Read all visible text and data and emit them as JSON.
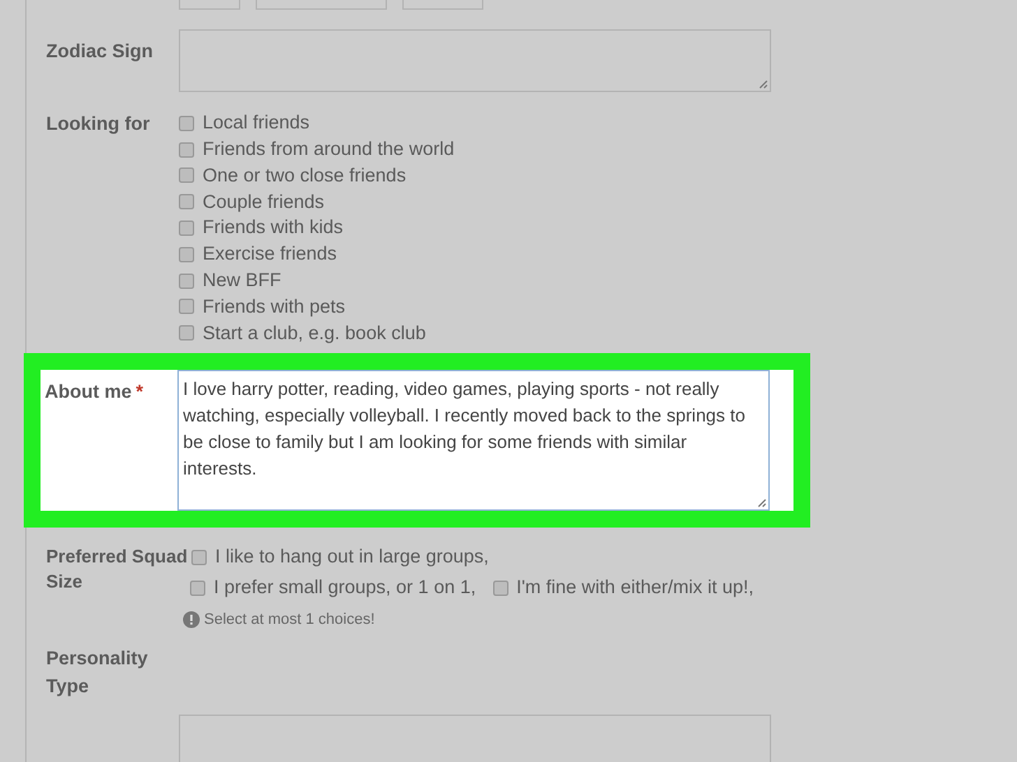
{
  "cut_off_fields": [
    {
      "kind": "field"
    },
    {
      "kind": "field"
    },
    {
      "kind": "field"
    }
  ],
  "zodiac": {
    "label": "Zodiac Sign"
  },
  "looking_for": {
    "label": "Looking for",
    "options": [
      {
        "label": "Local friends",
        "checked": false
      },
      {
        "label": "Friends from around the world",
        "checked": false
      },
      {
        "label": "One or two close friends",
        "checked": false
      },
      {
        "label": "Couple friends",
        "checked": false
      },
      {
        "label": "Friends with kids",
        "checked": false
      },
      {
        "label": "Exercise friends",
        "checked": false
      },
      {
        "label": "New BFF",
        "checked": false
      },
      {
        "label": "Friends with pets",
        "checked": false
      },
      {
        "label": "Start a club, e.g. book club",
        "checked": false
      }
    ]
  },
  "about_me": {
    "label": "About me",
    "required": true,
    "required_mark": "*",
    "highlighted": true,
    "value": "I love harry potter, reading, video games, playing sports - not really watching, especially volleyball. I recently moved back to the springs to be close to family but I am looking for some friends with similar interests."
  },
  "squad_size": {
    "label": "Preferred Squad Size",
    "options": [
      {
        "label": "I like to hang out in large groups,",
        "checked": false
      },
      {
        "label": "I prefer small groups, or 1 on 1,",
        "checked": false
      },
      {
        "label": "I'm fine with either/mix it up!,",
        "checked": false
      }
    ],
    "hint": "Select at most 1 choices!"
  },
  "personality": {
    "label": "Personality Type"
  }
}
